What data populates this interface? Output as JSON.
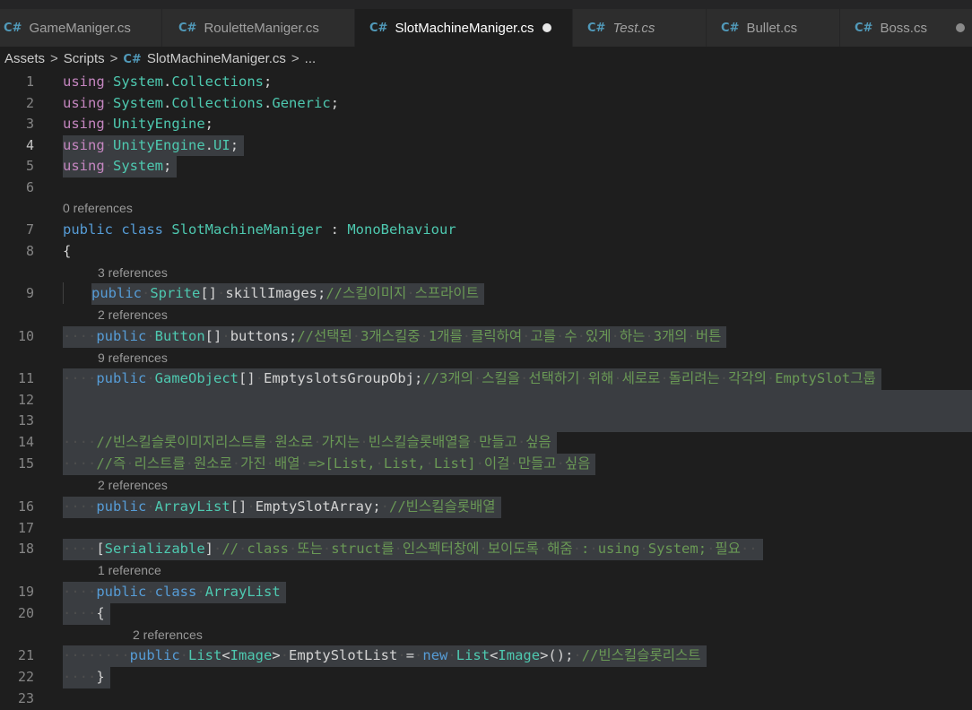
{
  "tabs": [
    {
      "label": "GameManiger.cs",
      "active": false,
      "italic": false,
      "dirty": false
    },
    {
      "label": "RouletteManiger.cs",
      "active": false,
      "italic": false,
      "dirty": false
    },
    {
      "label": "SlotMachineManiger.cs",
      "active": true,
      "italic": false,
      "dirty": true
    },
    {
      "label": "Test.cs",
      "active": false,
      "italic": true,
      "dirty": false
    },
    {
      "label": "Bullet.cs",
      "active": false,
      "italic": false,
      "dirty": false
    },
    {
      "label": "Boss.cs",
      "active": false,
      "italic": false,
      "dirty": true
    }
  ],
  "tab_icon": "C#",
  "breadcrumb": {
    "folder1": "Assets",
    "folder2": "Scripts",
    "file": "SlotMachineManiger.cs",
    "ellipsis": "..."
  },
  "codelens": {
    "l7": "0 references",
    "l9": "3 references",
    "l10": "2 references",
    "l11": "9 references",
    "l16": "2 references",
    "l19": "1 reference",
    "l21": "2 references"
  },
  "lines": {
    "l1": {
      "num": "1",
      "tokens": [
        [
          "pu",
          "using"
        ],
        [
          "ws",
          "·"
        ],
        [
          "ty",
          "System"
        ],
        [
          "pl",
          "."
        ],
        [
          "ty",
          "Collections"
        ],
        [
          "pl",
          ";"
        ]
      ]
    },
    "l2": {
      "num": "2",
      "tokens": [
        [
          "pu",
          "using"
        ],
        [
          "ws",
          "·"
        ],
        [
          "ty",
          "System"
        ],
        [
          "pl",
          "."
        ],
        [
          "ty",
          "Collections"
        ],
        [
          "pl",
          "."
        ],
        [
          "ty",
          "Generic"
        ],
        [
          "pl",
          ";"
        ]
      ]
    },
    "l3": {
      "num": "3",
      "tokens": [
        [
          "pu",
          "using"
        ],
        [
          "ws",
          "·"
        ],
        [
          "ty",
          "UnityEngine"
        ],
        [
          "pl",
          ";"
        ]
      ]
    },
    "l4": {
      "num": "4",
      "tokens": [
        [
          "pu",
          "using"
        ],
        [
          "ws",
          "·"
        ],
        [
          "ty",
          "UnityEngine"
        ],
        [
          "pl",
          "."
        ],
        [
          "ty",
          "UI"
        ],
        [
          "pl",
          ";"
        ]
      ]
    },
    "l5": {
      "num": "5",
      "tokens": [
        [
          "pu",
          "using"
        ],
        [
          "ws",
          "·"
        ],
        [
          "ty",
          "System"
        ],
        [
          "pl",
          ";"
        ]
      ]
    },
    "l6": {
      "num": "6",
      "tokens": []
    },
    "l7": {
      "num": "7",
      "tokens": [
        [
          "kw",
          "public"
        ],
        [
          "pl",
          " "
        ],
        [
          "kw",
          "class"
        ],
        [
          "pl",
          " "
        ],
        [
          "ty",
          "SlotMachineManiger"
        ],
        [
          "pl",
          " : "
        ],
        [
          "ty",
          "MonoBehaviour"
        ]
      ]
    },
    "l8": {
      "num": "8",
      "tokens": [
        [
          "pl",
          "{"
        ]
      ]
    },
    "l9": {
      "num": "9",
      "tokens": [
        [
          "kw",
          "public"
        ],
        [
          "ws",
          "·"
        ],
        [
          "ty",
          "Sprite"
        ],
        [
          "pl",
          "[]"
        ],
        [
          "ws",
          "·"
        ],
        [
          "pl",
          "skillImages;"
        ],
        [
          "cm",
          "//스킬이미지"
        ],
        [
          "ws",
          "·"
        ],
        [
          "cm",
          "스프라이트"
        ]
      ]
    },
    "l10": {
      "num": "10",
      "tokens": [
        [
          "ws",
          "····"
        ],
        [
          "kw",
          "public"
        ],
        [
          "ws",
          "·"
        ],
        [
          "ty",
          "Button"
        ],
        [
          "pl",
          "[]"
        ],
        [
          "ws",
          "·"
        ],
        [
          "pl",
          "buttons;"
        ],
        [
          "cm",
          "//선택된"
        ],
        [
          "ws",
          "·"
        ],
        [
          "cm",
          "3개스킬중"
        ],
        [
          "ws",
          "·"
        ],
        [
          "cm",
          "1개를"
        ],
        [
          "ws",
          "·"
        ],
        [
          "cm",
          "클릭하여"
        ],
        [
          "ws",
          "·"
        ],
        [
          "cm",
          "고를"
        ],
        [
          "ws",
          "·"
        ],
        [
          "cm",
          "수"
        ],
        [
          "ws",
          "·"
        ],
        [
          "cm",
          "있게"
        ],
        [
          "ws",
          "·"
        ],
        [
          "cm",
          "하는"
        ],
        [
          "ws",
          "·"
        ],
        [
          "cm",
          "3개의"
        ],
        [
          "ws",
          "·"
        ],
        [
          "cm",
          "버튼"
        ]
      ]
    },
    "l11": {
      "num": "11",
      "tokens": [
        [
          "ws",
          "····"
        ],
        [
          "kw",
          "public"
        ],
        [
          "ws",
          "·"
        ],
        [
          "ty",
          "GameObject"
        ],
        [
          "pl",
          "[]"
        ],
        [
          "ws",
          "·"
        ],
        [
          "pl",
          "EmptyslotsGroupObj;"
        ],
        [
          "cm",
          "//3개의"
        ],
        [
          "ws",
          "·"
        ],
        [
          "cm",
          "스킬을"
        ],
        [
          "ws",
          "·"
        ],
        [
          "cm",
          "선택하기"
        ],
        [
          "ws",
          "·"
        ],
        [
          "cm",
          "위해"
        ],
        [
          "ws",
          "·"
        ],
        [
          "cm",
          "세로로"
        ],
        [
          "ws",
          "·"
        ],
        [
          "cm",
          "돌리려는"
        ],
        [
          "ws",
          "·"
        ],
        [
          "cm",
          "각각의"
        ],
        [
          "ws",
          "·"
        ],
        [
          "cm",
          "EmptySlot그룹"
        ]
      ]
    },
    "l12": {
      "num": "12",
      "tokens": []
    },
    "l13": {
      "num": "13",
      "tokens": []
    },
    "l14": {
      "num": "14",
      "tokens": [
        [
          "ws",
          "····"
        ],
        [
          "cm",
          "//빈스킬슬롯이미지리스트를"
        ],
        [
          "ws",
          "·"
        ],
        [
          "cm",
          "원소로"
        ],
        [
          "ws",
          "·"
        ],
        [
          "cm",
          "가지는"
        ],
        [
          "ws",
          "·"
        ],
        [
          "cm",
          "빈스킬슬롯배열을"
        ],
        [
          "ws",
          "·"
        ],
        [
          "cm",
          "만들고"
        ],
        [
          "ws",
          "·"
        ],
        [
          "cm",
          "싶음"
        ]
      ]
    },
    "l15": {
      "num": "15",
      "tokens": [
        [
          "ws",
          "····"
        ],
        [
          "cm",
          "//즉"
        ],
        [
          "ws",
          "·"
        ],
        [
          "cm",
          "리스트를"
        ],
        [
          "ws",
          "·"
        ],
        [
          "cm",
          "원소로"
        ],
        [
          "ws",
          "·"
        ],
        [
          "cm",
          "가진"
        ],
        [
          "ws",
          "·"
        ],
        [
          "cm",
          "배열"
        ],
        [
          "ws",
          "·"
        ],
        [
          "cm",
          "=>[List,"
        ],
        [
          "ws",
          "·"
        ],
        [
          "cm",
          "List,"
        ],
        [
          "ws",
          "·"
        ],
        [
          "cm",
          "List]"
        ],
        [
          "ws",
          "·"
        ],
        [
          "cm",
          "이걸"
        ],
        [
          "ws",
          "·"
        ],
        [
          "cm",
          "만들고"
        ],
        [
          "ws",
          "·"
        ],
        [
          "cm",
          "싶음"
        ]
      ]
    },
    "l16": {
      "num": "16",
      "tokens": [
        [
          "ws",
          "····"
        ],
        [
          "kw",
          "public"
        ],
        [
          "ws",
          "·"
        ],
        [
          "ty",
          "ArrayList"
        ],
        [
          "pl",
          "[]"
        ],
        [
          "ws",
          "·"
        ],
        [
          "pl",
          "EmptySlotArray;"
        ],
        [
          "ws",
          "·"
        ],
        [
          "cm",
          "//빈스킬슬롯배열"
        ]
      ]
    },
    "l17": {
      "num": "17",
      "tokens": []
    },
    "l18": {
      "num": "18",
      "tokens": [
        [
          "ws",
          "····"
        ],
        [
          "pl",
          "["
        ],
        [
          "ty",
          "Serializable"
        ],
        [
          "pl",
          "]"
        ],
        [
          "ws",
          "·"
        ],
        [
          "cm",
          "//"
        ],
        [
          "ws",
          "·"
        ],
        [
          "cm",
          "class"
        ],
        [
          "ws",
          "·"
        ],
        [
          "cm",
          "또는"
        ],
        [
          "ws",
          "·"
        ],
        [
          "cm",
          "struct를"
        ],
        [
          "ws",
          "·"
        ],
        [
          "cm",
          "인스펙터창에"
        ],
        [
          "ws",
          "·"
        ],
        [
          "cm",
          "보이도록"
        ],
        [
          "ws",
          "·"
        ],
        [
          "cm",
          "해줌"
        ],
        [
          "ws",
          "·"
        ],
        [
          "cm",
          ":"
        ],
        [
          "ws",
          "·"
        ],
        [
          "cm",
          "using"
        ],
        [
          "ws",
          "·"
        ],
        [
          "cm",
          "System;"
        ],
        [
          "ws",
          "·"
        ],
        [
          "cm",
          "필요"
        ],
        [
          "ws",
          "··"
        ]
      ]
    },
    "l19": {
      "num": "19",
      "tokens": [
        [
          "ws",
          "····"
        ],
        [
          "kw",
          "public"
        ],
        [
          "ws",
          "·"
        ],
        [
          "kw",
          "class"
        ],
        [
          "ws",
          "·"
        ],
        [
          "ty",
          "ArrayList"
        ]
      ]
    },
    "l20": {
      "num": "20",
      "tokens": [
        [
          "ws",
          "····"
        ],
        [
          "pl",
          "{"
        ]
      ]
    },
    "l21": {
      "num": "21",
      "tokens": [
        [
          "ws",
          "········"
        ],
        [
          "kw",
          "public"
        ],
        [
          "ws",
          "·"
        ],
        [
          "ty",
          "List"
        ],
        [
          "pl",
          "<"
        ],
        [
          "ty",
          "Image"
        ],
        [
          "pl",
          ">"
        ],
        [
          "ws",
          "·"
        ],
        [
          "pl",
          "EmptySlotList"
        ],
        [
          "ws",
          "·"
        ],
        [
          "pl",
          "="
        ],
        [
          "ws",
          "·"
        ],
        [
          "kw",
          "new"
        ],
        [
          "ws",
          "·"
        ],
        [
          "ty",
          "List"
        ],
        [
          "pl",
          "<"
        ],
        [
          "ty",
          "Image"
        ],
        [
          "pl",
          ">();"
        ],
        [
          "ws",
          "·"
        ],
        [
          "cm",
          "//빈스킬슬롯리스트"
        ]
      ]
    },
    "l22": {
      "num": "22",
      "tokens": [
        [
          "ws",
          "····"
        ],
        [
          "pl",
          "}"
        ]
      ]
    },
    "l23": {
      "num": "23",
      "tokens": []
    }
  }
}
